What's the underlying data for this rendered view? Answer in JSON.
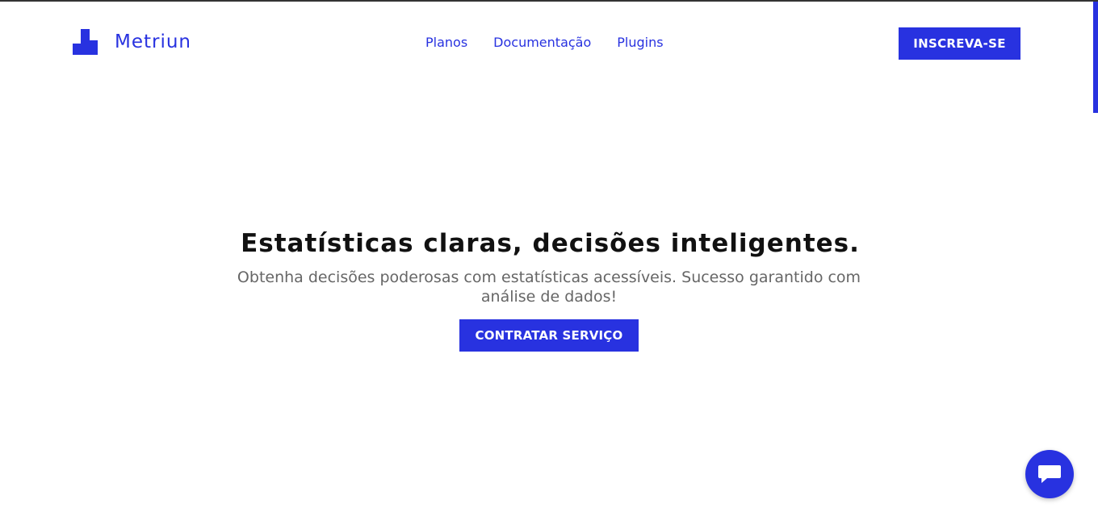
{
  "brand": {
    "name": "Metriun",
    "accent_color": "#2832e0"
  },
  "nav": {
    "items": [
      {
        "label": "Planos"
      },
      {
        "label": "Documentação"
      },
      {
        "label": "Plugins"
      }
    ]
  },
  "header": {
    "signup_label": "INSCREVA-SE"
  },
  "hero": {
    "title": "Estatísticas claras, decisões inteligentes.",
    "subtitle": "Obtenha decisões poderosas com estatísticas acessíveis. Sucesso garantido com análise de dados!",
    "cta_label": "CONTRATAR SERVIÇO"
  },
  "chat": {
    "icon": "chat-bubble-icon"
  }
}
